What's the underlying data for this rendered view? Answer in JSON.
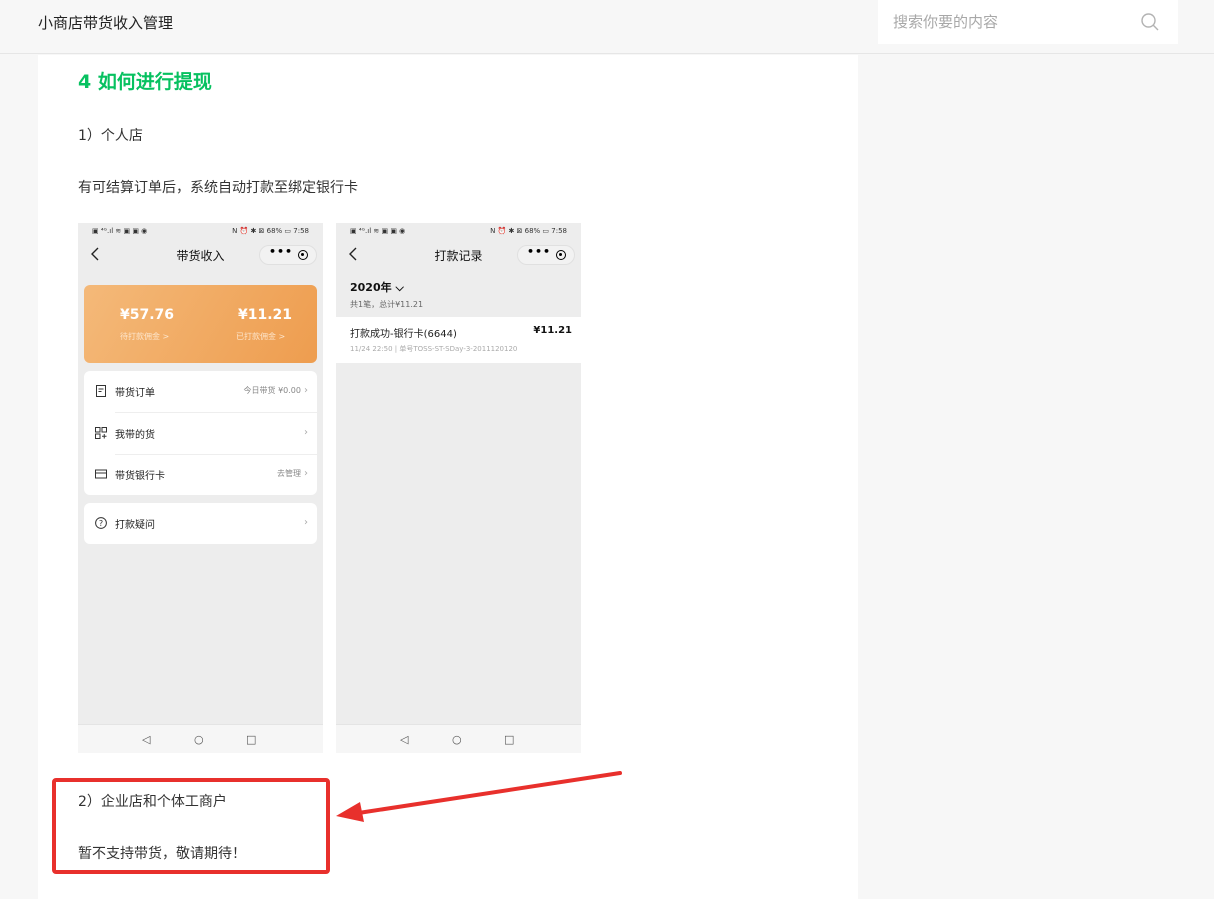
{
  "header": {
    "doc_title": "小商店带货收入管理",
    "search_placeholder": "搜索你要的内容"
  },
  "article": {
    "heading": "4 如何进行提现",
    "p_personal": "1）个人店",
    "p_personal_desc": "有可结算订单后，系统自动打款至绑定银行卡",
    "p_enterprise": "2）企业店和个体工商户",
    "p_enterprise_desc": "暂不支持带货，敬请期待！"
  },
  "phone1": {
    "status_left": "▣ ⁴ᴳ.ıl ≋ ▣ ▣ ◉",
    "status_right": "N ⏰ ✱ ⊠ 68% ▭ 7:58",
    "title": "带货收入",
    "pending_amount": "¥57.76",
    "pending_label": "待打款佣金 >",
    "paid_amount": "¥11.21",
    "paid_label": "已打款佣金 >",
    "menu": [
      {
        "label": "带货订单",
        "side": "今日带货 ¥0.00"
      },
      {
        "label": "我带的货",
        "side": ""
      },
      {
        "label": "带货银行卡",
        "side": "去管理"
      }
    ],
    "help_label": "打款疑问"
  },
  "phone2": {
    "status_left": "▣ ⁴ᴳ.ıl ≋ ▣ ▣ ◉",
    "status_right": "N ⏰ ✱ ⊠ 68% ▭ 7:58",
    "title": "打款记录",
    "year": "2020年",
    "summary": "共1笔，总计¥11.21",
    "record_title": "打款成功-银行卡(6644)",
    "record_amount": "¥11.21",
    "record_meta": "11/24 22:50 | 单号TOSS-ST-SDay-3-2011120120"
  },
  "colors": {
    "heading_green": "#07c160",
    "callout_red": "#e8302c",
    "card_orange": "#ee9d4f"
  }
}
